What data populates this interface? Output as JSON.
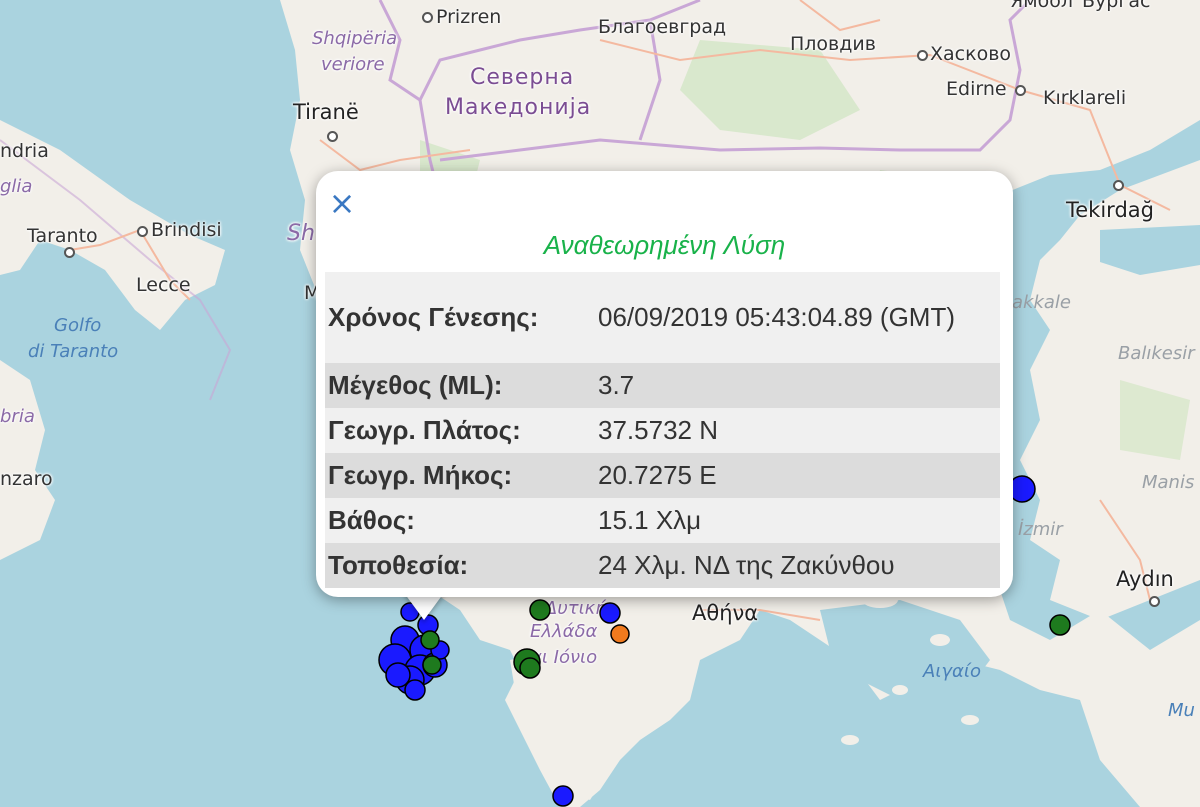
{
  "map": {
    "labels": {
      "prizren": "Prizren",
      "blagoevgrad": "Благоевград",
      "plovdiv": "Пловдив",
      "haskovo": "Хасково",
      "shqiperia": "Shqipëria",
      "veriore": "veriore",
      "severna": "Северна",
      "makedonija": "Македонија",
      "edirne": "Edirne",
      "kirklareli": "Kırklareli",
      "tirane": "Tiranë",
      "ndria": "ndria",
      "glia": "glia",
      "taranto": "Taranto",
      "brindisi": "Brindisi",
      "lecce": "Lecce",
      "golfo": "Golfo",
      "di_taranto": "di Taranto",
      "bria": "bria",
      "nzaro": "nzaro",
      "tekirdag": "Tekirdağ",
      "akkale": "akkale",
      "balikesir": "Balıkesir",
      "izmir": "İzmir",
      "manis": "Manis",
      "aydin": "Aydın",
      "athina": "Αθήνα",
      "dytiki": "Δυτική",
      "ellada": "Ελλάδα",
      "ionio": "αι Ιόνιο",
      "aigaio": "Αιγαίο",
      "mu": "Mu",
      "yambol": "Ямбол",
      "burgas": "Бургас",
      "sh": "Sh",
      "m": "M"
    },
    "marker_colors": {
      "blue": "#1a1aff",
      "green": "#1e7a1e",
      "orange": "#f07a1e"
    }
  },
  "popup": {
    "close_symbol": "×",
    "title": "Αναθεωρημένη Λύση",
    "title_color": "#19b24a",
    "rows": [
      {
        "key": "Χρόνος Γένεσης:",
        "value": "06/09/2019 05:43:04.89 (GMT)"
      },
      {
        "key": "Μέγεθος (ML):",
        "value": "3.7"
      },
      {
        "key": "Γεωγρ. Πλάτος:",
        "value": "37.5732 N"
      },
      {
        "key": "Γεωγρ. Μήκος:",
        "value": "20.7275 E"
      },
      {
        "key": "Βάθος:",
        "value": "15.1 Χλμ"
      },
      {
        "key": "Τοποθεσία:",
        "value": "24 Χλμ. ΝΔ της Ζακύνθου"
      }
    ]
  }
}
